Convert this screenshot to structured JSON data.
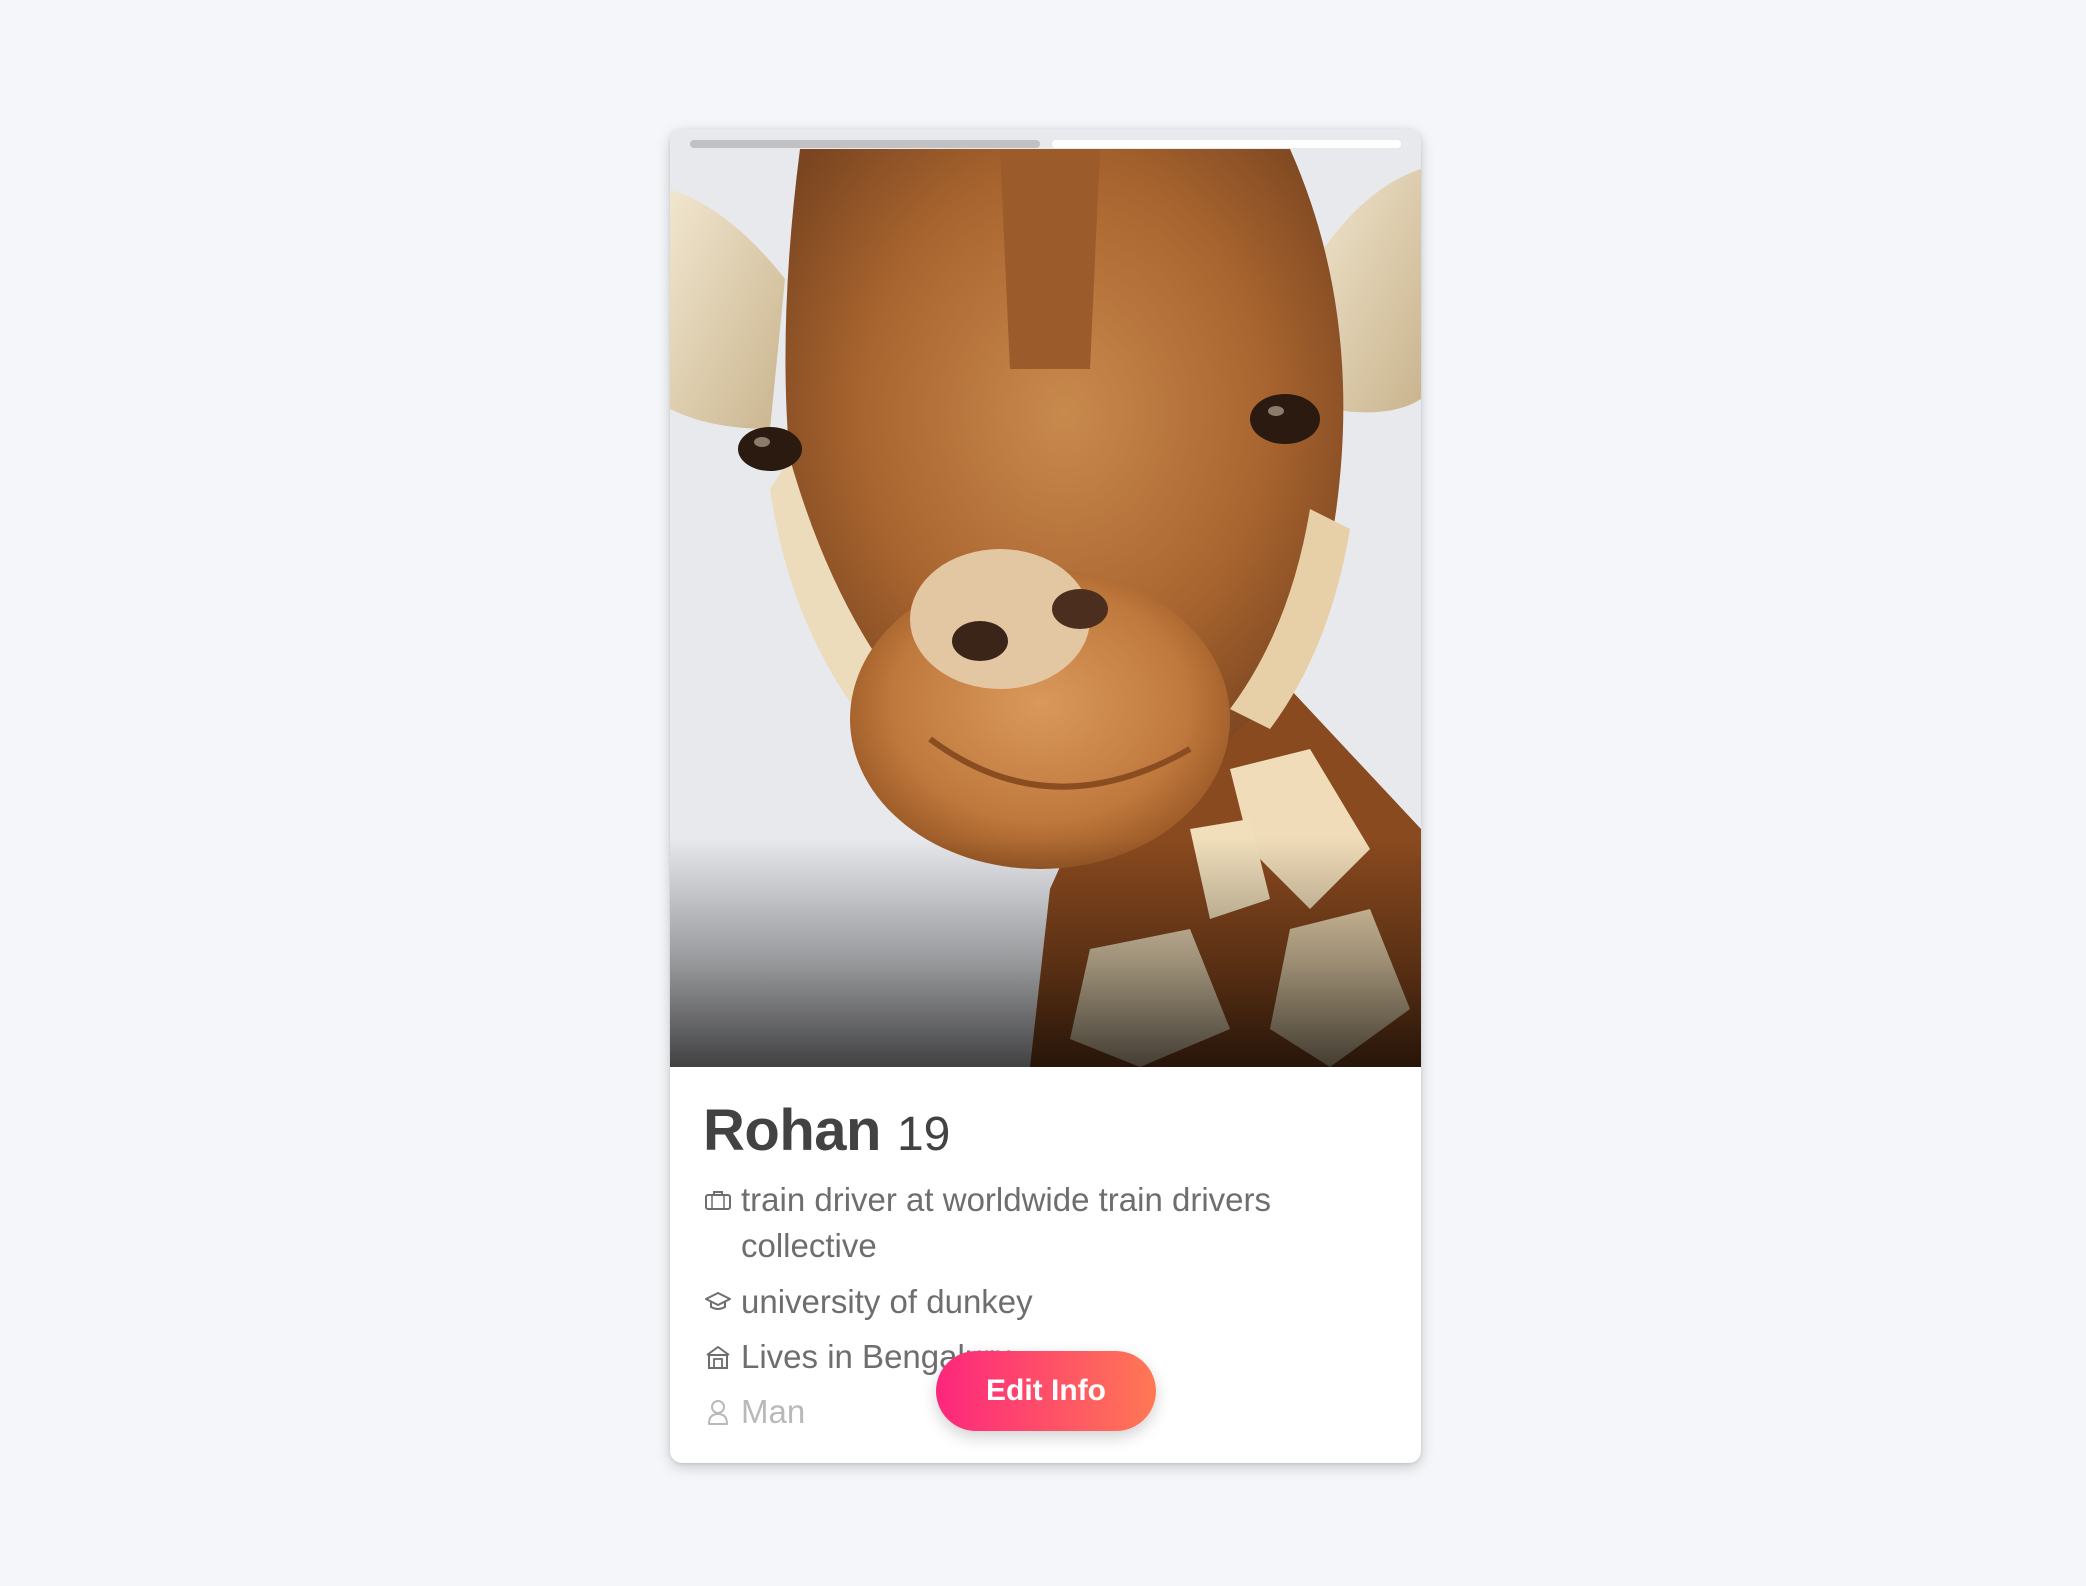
{
  "profile": {
    "name": "Rohan",
    "age": "19",
    "photo_subject": "giraffe-photo",
    "photos_total": 2,
    "photo_active_index": 2
  },
  "details": [
    {
      "icon": "briefcase-icon",
      "text": "train driver at worldwide train drivers collective"
    },
    {
      "icon": "graduation-cap-icon",
      "text": "university of dunkey"
    },
    {
      "icon": "home-icon",
      "text": "Lives in Bengaluru"
    },
    {
      "icon": "person-icon",
      "text": "Man"
    }
  ],
  "actions": {
    "edit_label": "Edit Info"
  },
  "colors": {
    "background": "#f4f6f9",
    "button_gradient_start": "#fd267d",
    "button_gradient_end": "#ff7854",
    "name_text": "#424242",
    "detail_text": "#6e6e6e"
  }
}
